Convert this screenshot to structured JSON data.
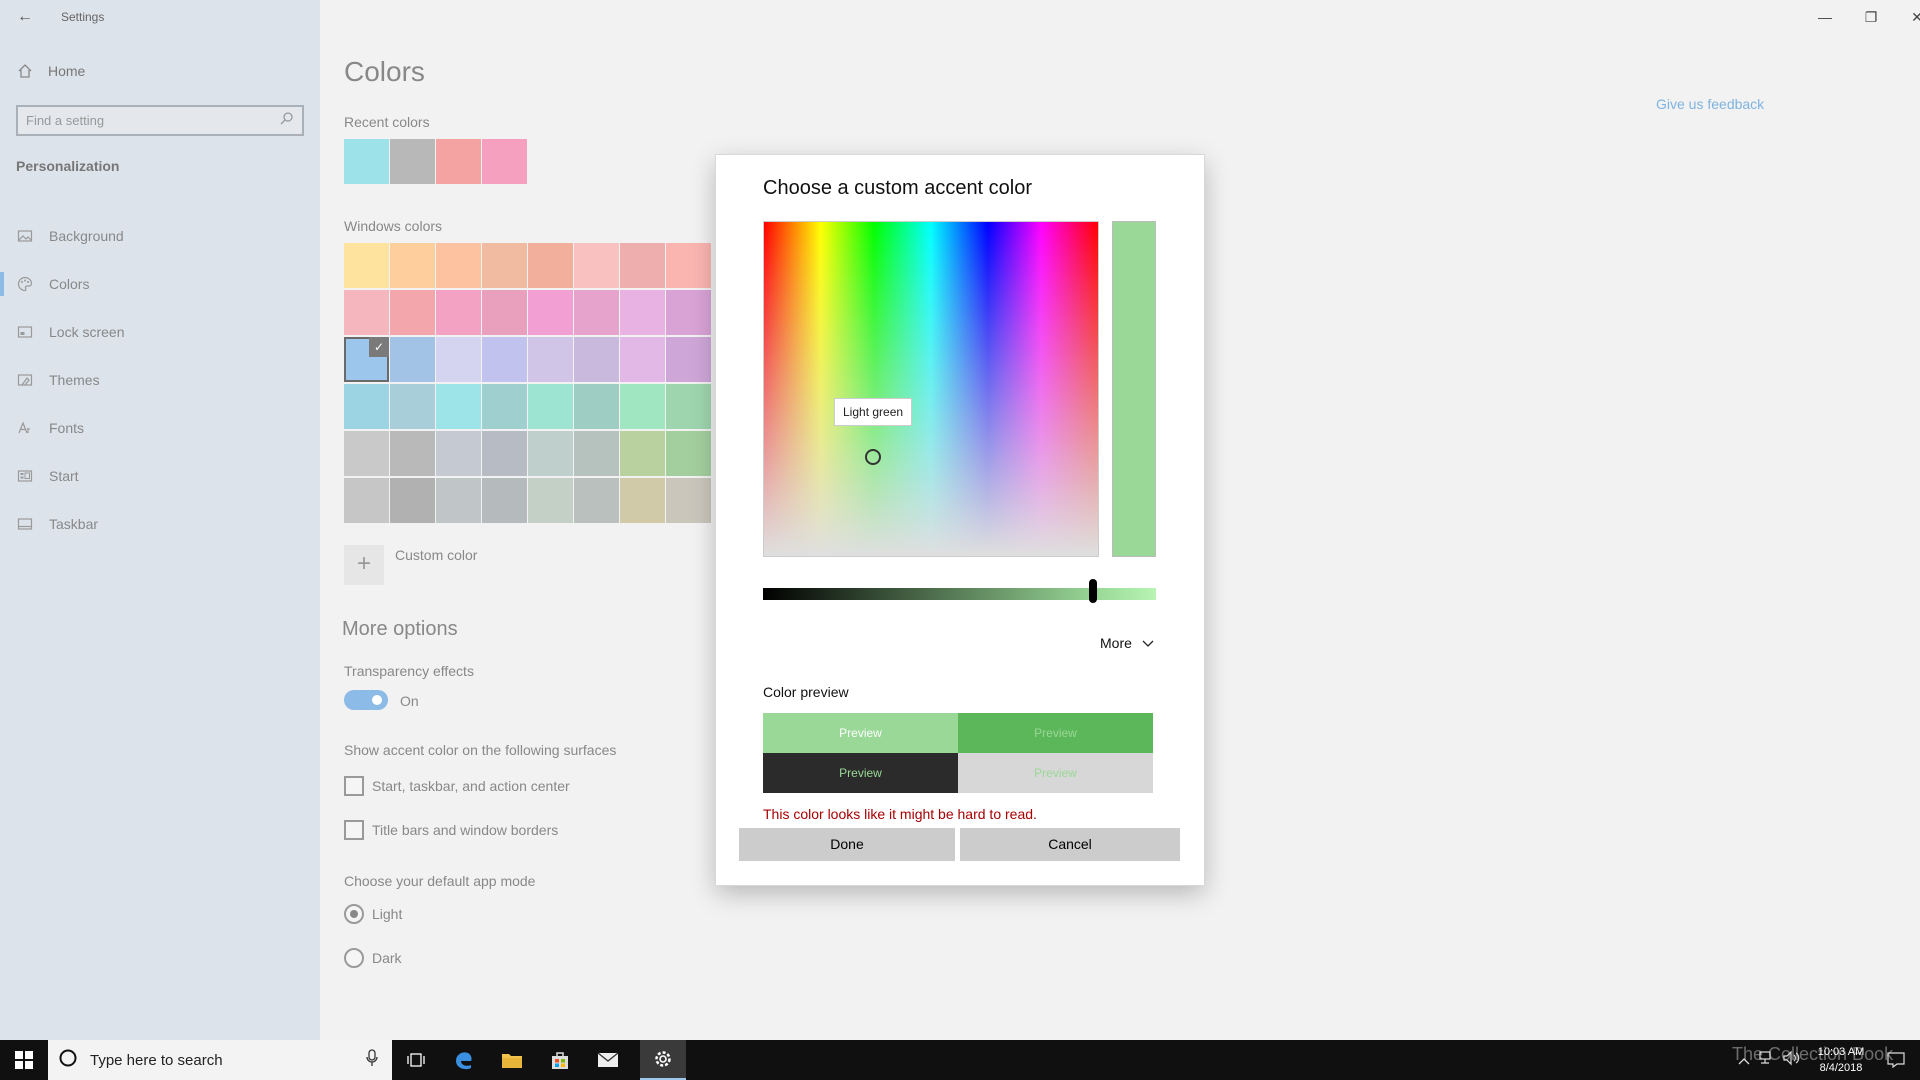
{
  "window": {
    "title": "Settings",
    "back_glyph": "←",
    "controls": {
      "minimize": "—",
      "maximize": "❐",
      "close": "✕"
    }
  },
  "sidebar": {
    "home_label": "Home",
    "search_placeholder": "Find a setting",
    "section_label": "Personalization",
    "items": [
      {
        "label": "Background",
        "icon": "picture-icon",
        "active": false
      },
      {
        "label": "Colors",
        "icon": "palette-icon",
        "active": true
      },
      {
        "label": "Lock screen",
        "icon": "lock-screen-icon",
        "active": false
      },
      {
        "label": "Themes",
        "icon": "themes-icon",
        "active": false
      },
      {
        "label": "Fonts",
        "icon": "fonts-icon",
        "active": false
      },
      {
        "label": "Start",
        "icon": "start-icon",
        "active": false
      },
      {
        "label": "Taskbar",
        "icon": "taskbar-icon",
        "active": false
      }
    ]
  },
  "main": {
    "title": "Colors",
    "feedback_link": "Give us feedback",
    "recent_colors_label": "Recent colors",
    "recent_colors": [
      "#9de2e8",
      "#b8b8b8",
      "#f5a2a2",
      "#f5a0bf"
    ],
    "windows_colors_label": "Windows colors",
    "windows_colors": [
      [
        "#fde39e",
        "#fecf9d",
        "#fdc29f",
        "#f0bba0",
        "#f2b09c",
        "#f9c2c0",
        "#efaeae",
        "#fbb5b1"
      ],
      [
        "#f6b6bd",
        "#f4a6ad",
        "#f3a2c3",
        "#e9a0bc",
        "#f2a0d4",
        "#e6a3cb",
        "#e8b2e2",
        "#d9a3d6"
      ],
      [
        "#9dc6ec",
        "#a2c3e6",
        "#d4d4f0",
        "#c2c2ef",
        "#d0c5e6",
        "#c9b9dd",
        "#e2b9e6",
        "#cfa6d8"
      ],
      [
        "#9dd4e4",
        "#a8ced9",
        "#9de4e8",
        "#9fd0cf",
        "#9de4d2",
        "#9ecdc4",
        "#a0e6c1",
        "#9fd5ae"
      ],
      [
        "#c9c9c9",
        "#b9b9b9",
        "#c5cad2",
        "#b7bcc4",
        "#bfd0cc",
        "#b6c2be",
        "#b9d09f",
        "#a3cf9f"
      ],
      [
        "#c6c6c6",
        "#b1b1b1",
        "#c0c6c8",
        "#b5babd",
        "#c4d0c6",
        "#b9c0bd",
        "#d0caa9",
        "#cac6bc"
      ]
    ],
    "selected_color": {
      "row": 2,
      "col": 0
    },
    "check_glyph": "✓",
    "custom_color_label": "Custom color",
    "plus_glyph": "+",
    "more_options_heading": "More options",
    "transparency_label": "Transparency effects",
    "transparency_state": "On",
    "accent_surfaces_label": "Show accent color on the following surfaces",
    "checkbox_start": "Start, taskbar, and action center",
    "checkbox_titlebars": "Title bars and window borders",
    "app_mode_label": "Choose your default app mode",
    "radio_light": "Light",
    "radio_dark": "Dark"
  },
  "dialog": {
    "title": "Choose a custom accent color",
    "tooltip": "Light green",
    "selected_color": "#99d897",
    "brightness_value": 0.84,
    "more_label": "More",
    "color_preview_label": "Color preview",
    "previews": [
      {
        "label": "Preview",
        "bg": "#99d897",
        "fg": "#ffffff"
      },
      {
        "label": "Preview",
        "bg": "#5cb65a",
        "fg": "#99d897"
      },
      {
        "label": "Preview",
        "bg": "#2b2b2b",
        "fg": "#99d897"
      },
      {
        "label": "Preview",
        "bg": "#d7d7d7",
        "fg": "#99d897"
      }
    ],
    "warning": "This color looks like it might be hard to read.",
    "done_label": "Done",
    "cancel_label": "Cancel"
  },
  "taskbar": {
    "search_placeholder": "Type here to search",
    "watermark": "The Collection Book",
    "time": "10:03 AM",
    "date": "8/4/2018"
  }
}
